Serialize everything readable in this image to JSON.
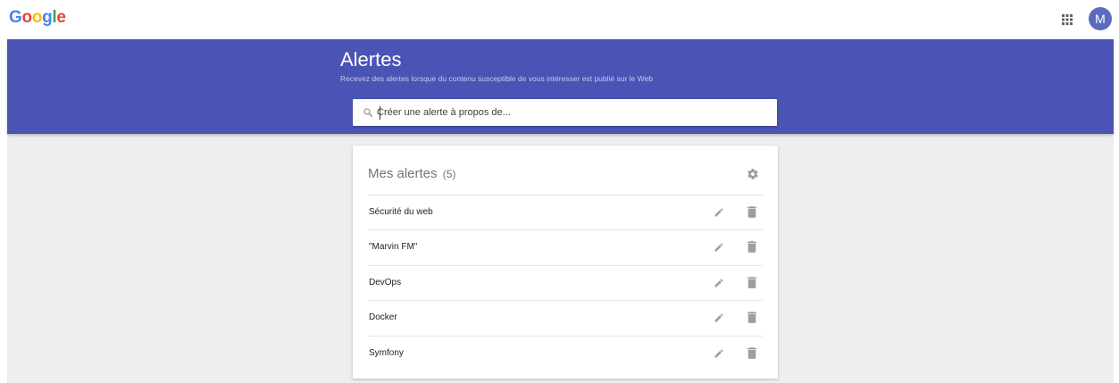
{
  "topbar": {
    "logo": [
      "G",
      "o",
      "o",
      "g",
      "l",
      "e"
    ],
    "apps_icon": "apps-grid-icon",
    "avatar_initial": "M"
  },
  "header": {
    "title": "Alertes",
    "subtitle": "Recevez des alertes lorsque du contenu susceptible de vous intéresser est publié sur le Web"
  },
  "search": {
    "placeholder": "Créer une alerte à propos de...",
    "value": ""
  },
  "alerts_card": {
    "title": "Mes alertes",
    "count": "(5)",
    "settings_icon": "gear-icon",
    "items": [
      {
        "label": "Sécurité du web"
      },
      {
        "label": "\"Marvin FM\""
      },
      {
        "label": "DevOps"
      },
      {
        "label": "Docker"
      },
      {
        "label": "Symfony"
      }
    ]
  },
  "colors": {
    "header_bg": "#4a54b5",
    "stage_bg": "#eeeeee",
    "avatar_bg": "#5c6bc0",
    "icon_gray": "#9e9e9e"
  }
}
